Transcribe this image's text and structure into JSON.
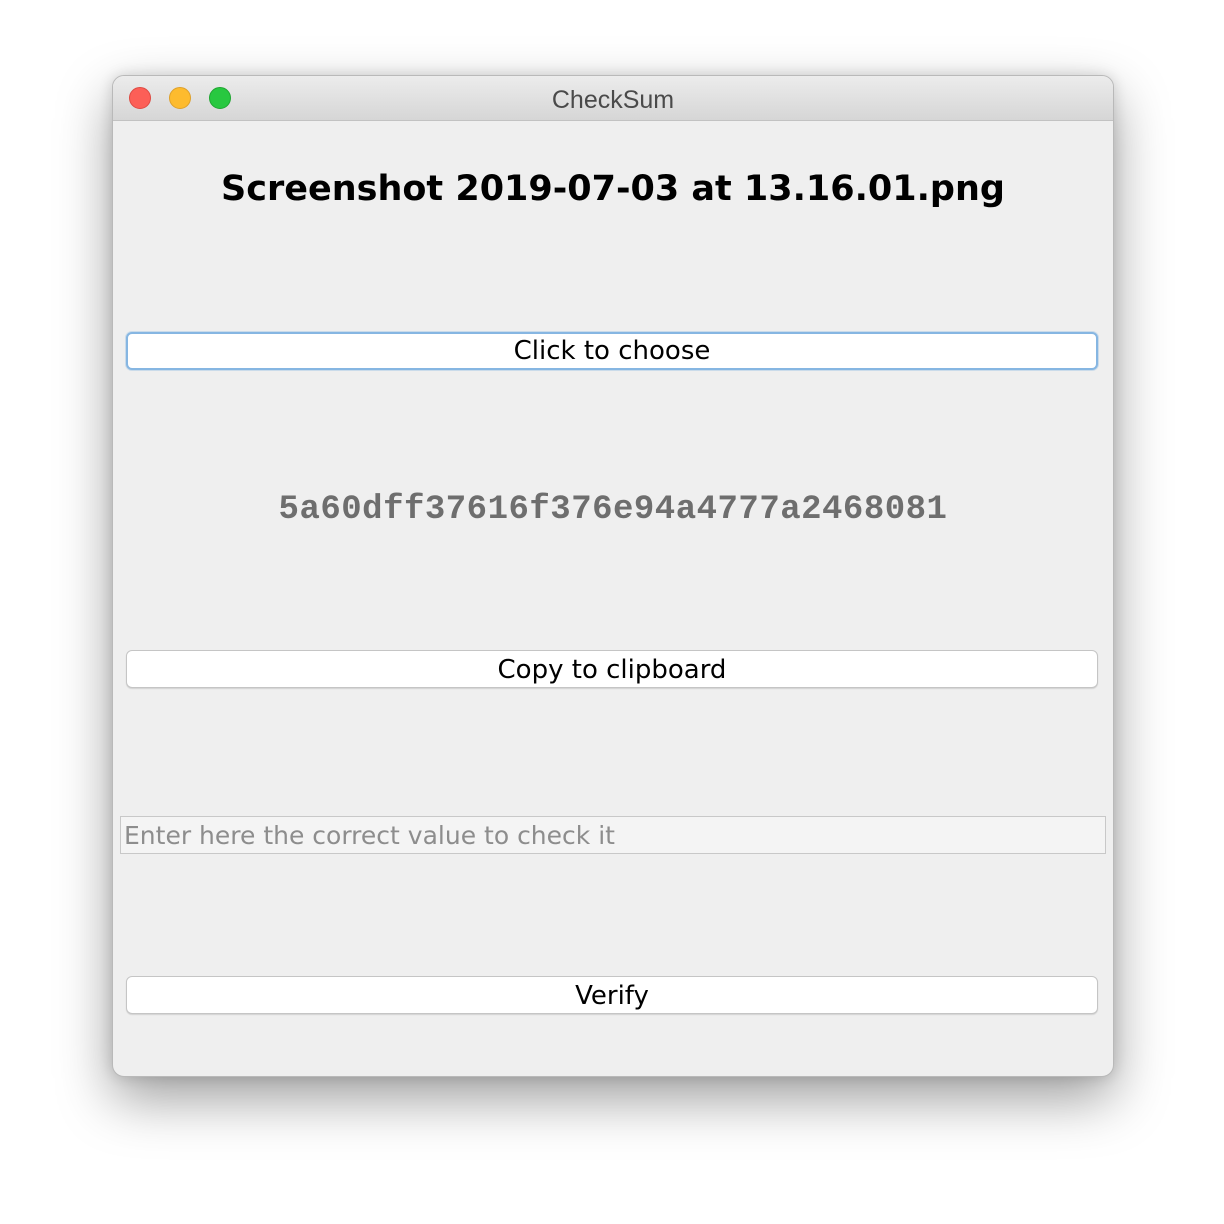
{
  "window": {
    "title": "CheckSum"
  },
  "file": {
    "name": "Screenshot 2019-07-03 at 13.16.01.png"
  },
  "buttons": {
    "choose_label": "Click to choose",
    "copy_label": "Copy to clipboard",
    "verify_label": "Verify"
  },
  "checksum": {
    "value": "5a60dff37616f376e94a4777a2468081"
  },
  "verify_field": {
    "value": "",
    "placeholder": "Enter here the correct value to check it"
  },
  "colors": {
    "close": "#fc5f57",
    "minimize": "#fdbb2e",
    "maximize": "#28c840",
    "focus_ring": "#86b6e2",
    "checksum_text": "#6e6e6e"
  }
}
